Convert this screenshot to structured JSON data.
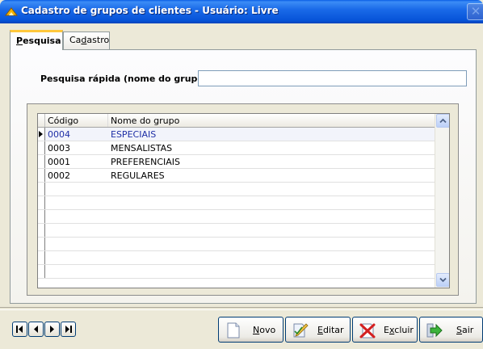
{
  "window": {
    "title": "Cadastro de grupos de clientes - Usuário: Livre"
  },
  "tabs": [
    {
      "label": "Pesquisa",
      "hotkey": "P",
      "rest": "esquisa",
      "active": true
    },
    {
      "label": "Cadastro",
      "pre": "Ca",
      "hotkey": "d",
      "rest": "astro",
      "active": false
    }
  ],
  "search": {
    "label": "Pesquisa rápida (nome do grupo)",
    "value": ""
  },
  "grid": {
    "columns": [
      "Código",
      "Nome do grupo"
    ],
    "rows": [
      {
        "codigo": "0004",
        "nome": "ESPECIAIS",
        "selected": true
      },
      {
        "codigo": "0003",
        "nome": "MENSALISTAS",
        "selected": false
      },
      {
        "codigo": "0001",
        "nome": "PREFERENCIAIS",
        "selected": false
      },
      {
        "codigo": "0002",
        "nome": "REGULARES",
        "selected": false
      }
    ]
  },
  "navigator": {
    "icons": [
      "first-icon",
      "prior-icon",
      "next-icon",
      "last-icon"
    ]
  },
  "actions": {
    "novo": {
      "hotkey": "N",
      "rest": "ovo",
      "icon": "new-document-icon"
    },
    "editar": {
      "hotkey": "E",
      "rest": "ditar",
      "icon": "edit-icon"
    },
    "excluir": {
      "pre": "E",
      "hotkey": "x",
      "rest": "cluir",
      "icon": "delete-icon"
    },
    "sair": {
      "hotkey": "S",
      "rest": "air",
      "icon": "exit-arrow-icon"
    }
  }
}
